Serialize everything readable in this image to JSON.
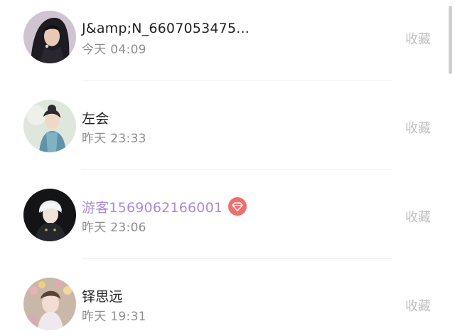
{
  "items": [
    {
      "name": "J&amp;N_6607053475...",
      "time": "今天 04:09",
      "action": "收藏",
      "vip": false
    },
    {
      "name": "左会",
      "time": "昨天 23:33",
      "action": "收藏",
      "vip": false
    },
    {
      "name": "游客1569062166001",
      "time": "昨天 23:06",
      "action": "收藏",
      "vip": true
    },
    {
      "name": "铎思远",
      "time": "昨天 19:31",
      "action": "收藏",
      "vip": false
    }
  ],
  "colors": {
    "vip_name": "#a98bd8",
    "vip_badge": "#f06e6e",
    "action_text": "#c0c0c0",
    "time_text": "#8d8d8d"
  },
  "icons": {
    "vip_badge": "diamond-icon"
  }
}
